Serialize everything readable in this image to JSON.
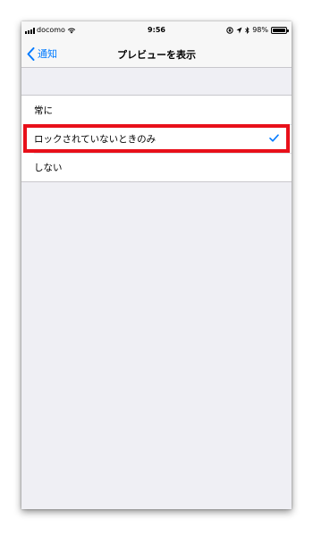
{
  "status_bar": {
    "carrier": "docomo",
    "time": "9:56",
    "battery_text": "98%",
    "battery_level": 0.98
  },
  "nav": {
    "back_label": "通知",
    "title": "プレビューを表示"
  },
  "options": [
    {
      "label": "常に",
      "selected": false
    },
    {
      "label": "ロックされていないときのみ",
      "selected": true,
      "highlighted": true
    },
    {
      "label": "しない",
      "selected": false
    }
  ],
  "colors": {
    "accent": "#007aff",
    "highlight_border": "#e8101a",
    "background": "#efeff4"
  }
}
